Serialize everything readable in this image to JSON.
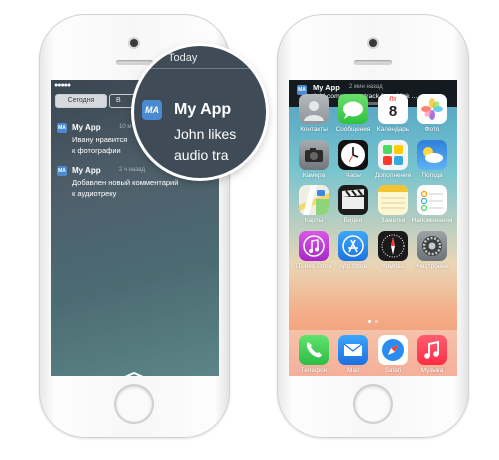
{
  "left_phone": {
    "today_header": "Today",
    "tabs": [
      {
        "label": "Сегодня",
        "selected": true
      },
      {
        "label": "В",
        "selected": false
      }
    ],
    "notifications": [
      {
        "app_badge": "MA",
        "app": "My App",
        "time": "10 м",
        "lines": [
          "Ивану нравится",
          "к фотографии"
        ]
      },
      {
        "app_badge": "MA",
        "app": "My App",
        "time": "2 ч назад",
        "lines": [
          "Добавлен новый комментарий",
          "к аудиотреку"
        ]
      }
    ],
    "magnifier": {
      "app_badge": "MA",
      "app": "My App",
      "header": "Today",
      "lines": [
        "John likes",
        "audio tra"
      ]
    }
  },
  "right_phone": {
    "banner": {
      "app": "My App",
      "time": "2 мин назад",
      "message": "Add comment to track from Nick ..."
    },
    "apps": [
      {
        "label": "Контакты",
        "icon": "contacts-icon",
        "color": "#9aa0a6"
      },
      {
        "label": "Сообщения",
        "icon": "messages-icon",
        "color": "#57d05a"
      },
      {
        "label": "Календарь",
        "icon": "calendar-icon",
        "color": "#ffffff"
      },
      {
        "label": "Фото",
        "icon": "photos-icon",
        "color": "#ffffff"
      },
      {
        "label": "Камера",
        "icon": "camera-icon",
        "color": "#8e9397"
      },
      {
        "label": "Часы",
        "icon": "clock-icon",
        "color": "#111111"
      },
      {
        "label": "Дополнения",
        "icon": "extras-icon",
        "color": "#ffffff"
      },
      {
        "label": "Погода",
        "icon": "weather-icon",
        "color": "#3d8ee0"
      },
      {
        "label": "Карты",
        "icon": "maps-icon",
        "color": "#ffffff"
      },
      {
        "label": "Видео",
        "icon": "videos-icon",
        "color": "#1c1c1c"
      },
      {
        "label": "Заметки",
        "icon": "notes-icon",
        "color": "#fff7d0"
      },
      {
        "label": "Напоминания",
        "icon": "reminders-icon",
        "color": "#ffffff"
      },
      {
        "label": "iTunes Store",
        "icon": "itunes-store-icon",
        "color": "#c43fd4"
      },
      {
        "label": "App Store",
        "icon": "app-store-icon",
        "color": "#2d8ff0"
      },
      {
        "label": "Компас",
        "icon": "compass-icon",
        "color": "#1a1a1a"
      },
      {
        "label": "Настройки",
        "icon": "settings-icon",
        "color": "#8e9399"
      }
    ],
    "dock": [
      {
        "label": "Телефон",
        "icon": "phone-icon",
        "color": "#4cd964"
      },
      {
        "label": "Mail",
        "icon": "mail-icon",
        "color": "#2a8cf0"
      },
      {
        "label": "Safari",
        "icon": "safari-icon",
        "color": "#ffffff"
      },
      {
        "label": "Музыка",
        "icon": "music-icon",
        "color": "#ff3b4f"
      }
    ]
  }
}
